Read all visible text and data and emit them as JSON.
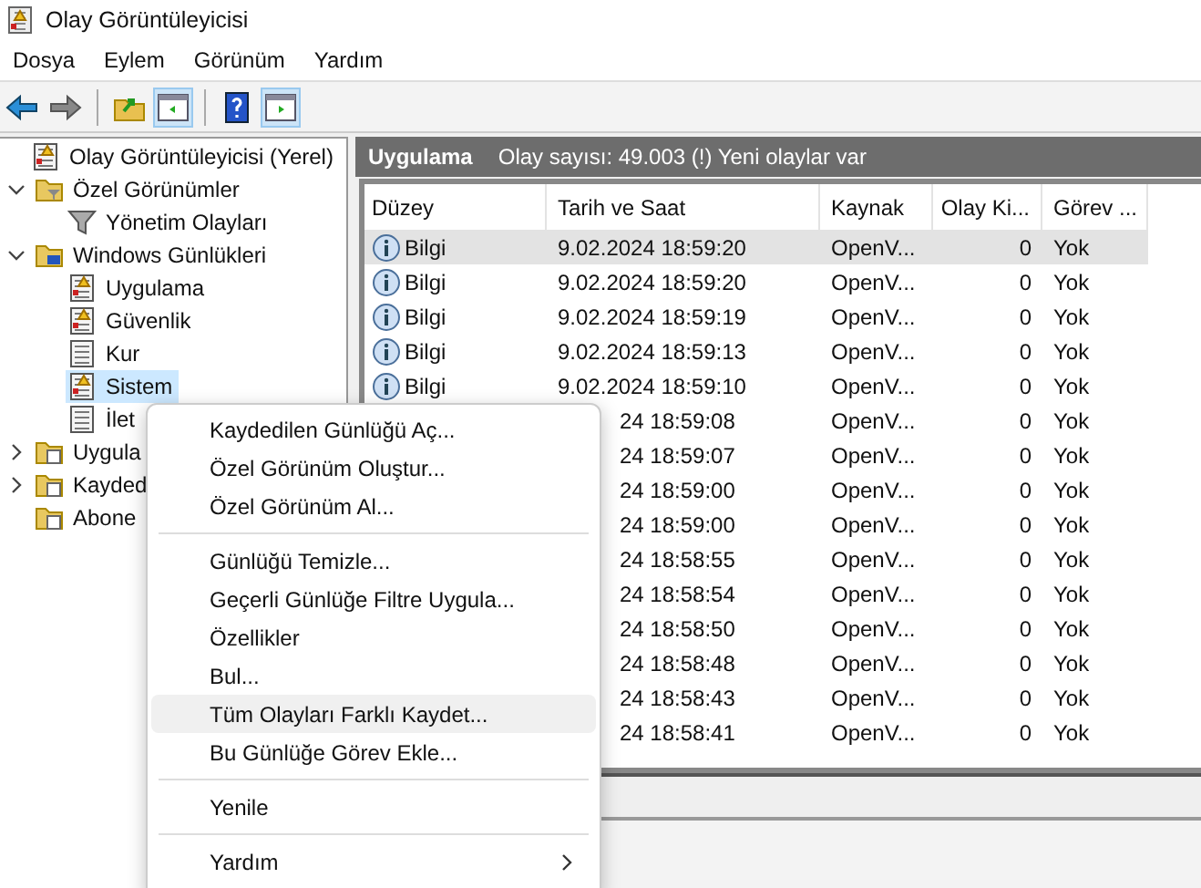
{
  "window": {
    "title": "Olay Görüntüleyicisi"
  },
  "menu_bar": [
    "Dosya",
    "Eylem",
    "Görünüm",
    "Yardım"
  ],
  "toolbar": [
    {
      "kind": "back",
      "pressed": false
    },
    {
      "kind": "forward",
      "pressed": false
    },
    {
      "kind": "separator"
    },
    {
      "kind": "folder-up",
      "pressed": false
    },
    {
      "kind": "pane-left",
      "pressed": true
    },
    {
      "kind": "separator"
    },
    {
      "kind": "help",
      "pressed": false
    },
    {
      "kind": "pane-right",
      "pressed": true
    }
  ],
  "tree": [
    {
      "label": "Olay Görüntüleyicisi (Yerel)",
      "kind": "viewer",
      "selected": false,
      "children": [
        {
          "label": "Özel Görünümler",
          "kind": "filter-folder",
          "expanded": true,
          "selected": false,
          "children": [
            {
              "label": "Yönetim Olayları",
              "kind": "filter",
              "selected": false
            }
          ]
        },
        {
          "label": "Windows Günlükleri",
          "kind": "pc-folder",
          "expanded": true,
          "selected": false,
          "children": [
            {
              "label": "Uygulama",
              "kind": "log",
              "selected": false
            },
            {
              "label": "Güvenlik",
              "kind": "log",
              "selected": false
            },
            {
              "label": "Kur",
              "kind": "plain-log",
              "selected": false
            },
            {
              "label": "Sistem",
              "kind": "log",
              "selected": true
            },
            {
              "label": "İlet",
              "kind": "plain-log",
              "selected": false
            }
          ]
        },
        {
          "label": "Uygula",
          "kind": "doc-folder",
          "expanded": false,
          "selected": false
        },
        {
          "label": "Kayded",
          "kind": "doc-folder",
          "expanded": false,
          "selected": false
        },
        {
          "label": "Abone",
          "kind": "sub-folder",
          "selected": false
        }
      ]
    }
  ],
  "panel": {
    "title": "Uygulama",
    "summary": "Olay sayısı: 49.003 (!) Yeni olaylar var"
  },
  "table": {
    "columns": [
      "Düzey",
      "Tarih ve Saat",
      "Kaynak",
      "Olay Ki...",
      "Görev ..."
    ],
    "rows": [
      {
        "level": "Bilgi",
        "date": "9.02.2024 18:59:20",
        "source": "OpenV...",
        "event_id": "0",
        "task": "Yok",
        "selected": true
      },
      {
        "level": "Bilgi",
        "date": "9.02.2024 18:59:20",
        "source": "OpenV...",
        "event_id": "0",
        "task": "Yok",
        "selected": false
      },
      {
        "level": "Bilgi",
        "date": "9.02.2024 18:59:19",
        "source": "OpenV...",
        "event_id": "0",
        "task": "Yok",
        "selected": false
      },
      {
        "level": "Bilgi",
        "date": "9.02.2024 18:59:13",
        "source": "OpenV...",
        "event_id": "0",
        "task": "Yok",
        "selected": false
      },
      {
        "level": "Bilgi",
        "date": "9.02.2024 18:59:10",
        "source": "OpenV...",
        "event_id": "0",
        "task": "Yok",
        "selected": false
      },
      {
        "date": "24 18:59:08",
        "source": "OpenV...",
        "event_id": "0",
        "task": "Yok",
        "selected": false
      },
      {
        "date": "24 18:59:07",
        "source": "OpenV...",
        "event_id": "0",
        "task": "Yok",
        "selected": false
      },
      {
        "date": "24 18:59:00",
        "source": "OpenV...",
        "event_id": "0",
        "task": "Yok",
        "selected": false
      },
      {
        "date": "24 18:59:00",
        "source": "OpenV...",
        "event_id": "0",
        "task": "Yok",
        "selected": false
      },
      {
        "date": "24 18:58:55",
        "source": "OpenV...",
        "event_id": "0",
        "task": "Yok",
        "selected": false
      },
      {
        "date": "24 18:58:54",
        "source": "OpenV...",
        "event_id": "0",
        "task": "Yok",
        "selected": false
      },
      {
        "date": "24 18:58:50",
        "source": "OpenV...",
        "event_id": "0",
        "task": "Yok",
        "selected": false
      },
      {
        "date": "24 18:58:48",
        "source": "OpenV...",
        "event_id": "0",
        "task": "Yok",
        "selected": false
      },
      {
        "date": "24 18:58:43",
        "source": "OpenV...",
        "event_id": "0",
        "task": "Yok",
        "selected": false
      },
      {
        "date": "24 18:58:41",
        "source": "OpenV...",
        "event_id": "0",
        "task": "Yok",
        "selected": false
      }
    ]
  },
  "context_menu": [
    {
      "kind": "item",
      "label": "Kaydedilen Günlüğü Aç...",
      "highlighted": false
    },
    {
      "kind": "item",
      "label": "Özel Görünüm Oluştur...",
      "highlighted": false
    },
    {
      "kind": "item",
      "label": "Özel Görünüm Al...",
      "highlighted": false
    },
    {
      "kind": "separator"
    },
    {
      "kind": "item",
      "label": "Günlüğü Temizle...",
      "highlighted": false
    },
    {
      "kind": "item",
      "label": "Geçerli Günlüğe Filtre Uygula...",
      "highlighted": false
    },
    {
      "kind": "item",
      "label": "Özellikler",
      "highlighted": false
    },
    {
      "kind": "item",
      "label": "Bul...",
      "highlighted": false
    },
    {
      "kind": "item",
      "label": "Tüm Olayları Farklı Kaydet...",
      "highlighted": true
    },
    {
      "kind": "item",
      "label": "Bu Günlüğe Görev Ekle...",
      "highlighted": false
    },
    {
      "kind": "separator"
    },
    {
      "kind": "item",
      "label": "Yenile",
      "highlighted": false
    },
    {
      "kind": "separator"
    },
    {
      "kind": "submenu",
      "label": "Yardım",
      "highlighted": false
    }
  ]
}
